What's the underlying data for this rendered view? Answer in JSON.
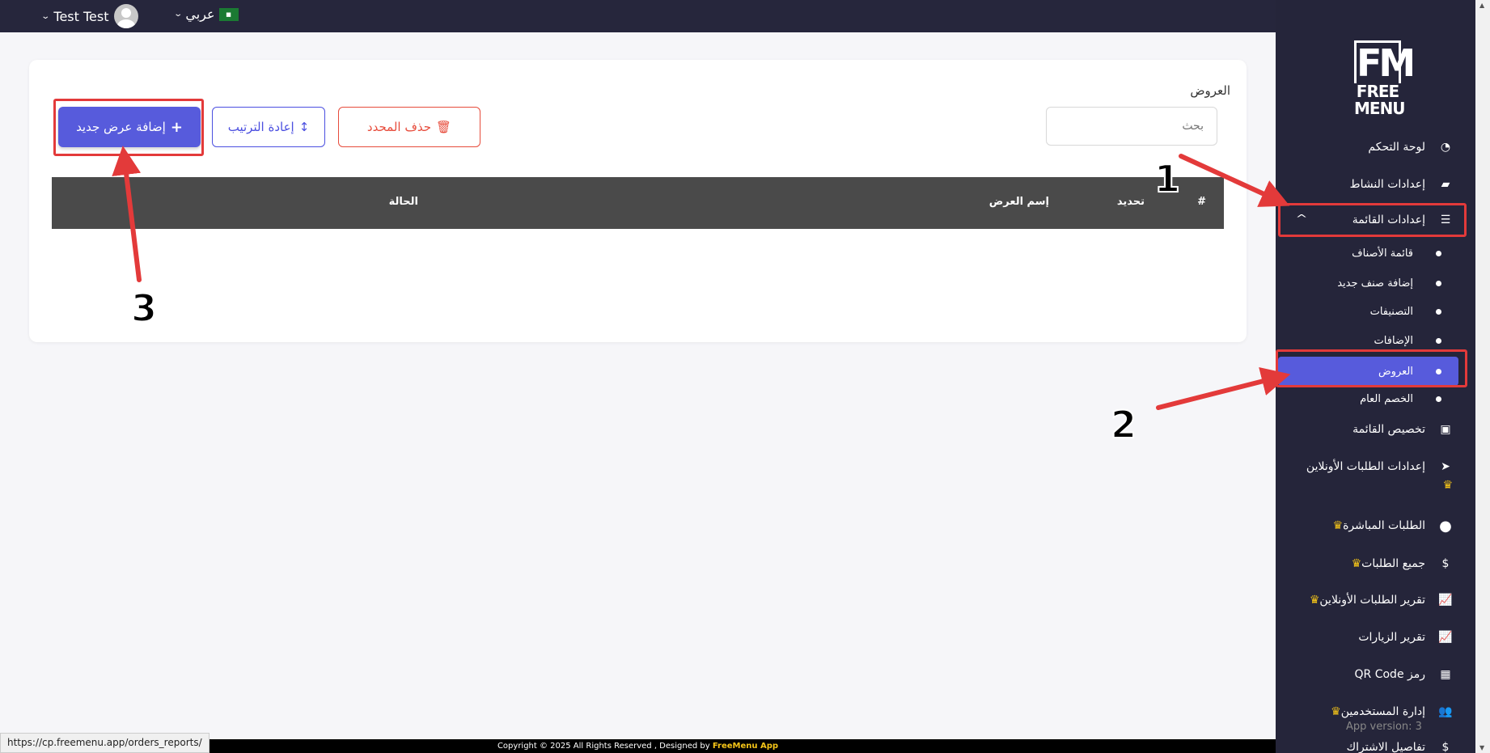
{
  "topbar": {
    "user_name": "Test Test",
    "language": "عربي",
    "flag_text": "Saudi"
  },
  "main": {
    "title": "العروض",
    "search_placeholder": "بحث",
    "delete_selected_label": "حذف المحدد",
    "reorder_label": "إعادة الترتيب",
    "add_offer_label": "إضافة عرض جديد",
    "table_headers": [
      "#",
      "تحديد",
      "إسم العرض",
      "الحالة"
    ]
  },
  "sidebar": {
    "logo_letters": "FM",
    "logo_line1": "FREE",
    "logo_line2": "MENU",
    "items": [
      {
        "label": "لوحة التحكم",
        "icon": "dashboard-icon"
      },
      {
        "label": "إعدادات النشاط",
        "icon": "briefcase-icon"
      },
      {
        "label": "إعدادات القائمة",
        "icon": "burger-icon"
      },
      {
        "label": "تخصيص القائمة",
        "icon": "images-icon"
      },
      {
        "label": "إعدادات الطلبات الأونلاين",
        "icon": "telegram-icon",
        "premium": true
      },
      {
        "label": "الطلبات المباشرة",
        "icon": "circle-icon",
        "premium": true
      },
      {
        "label": "جميع الطلبات",
        "icon": "money-bag-icon",
        "premium": true
      },
      {
        "label": "تقرير الطلبات الأونلاين",
        "icon": "chart-line-icon",
        "premium": true
      },
      {
        "label": "تقرير الزيارات",
        "icon": "chart-line-icon"
      },
      {
        "label": "رمز QR Code",
        "icon": "qrcode-icon"
      },
      {
        "label": "إدارة المستخدمين",
        "icon": "users-icon",
        "premium": true
      },
      {
        "label": "تفاصيل الاشتراك",
        "icon": "subscription-icon"
      }
    ],
    "sub_items": [
      "قائمة الأصناف",
      "إضافة صنف جديد",
      "التصنيفات",
      "الإضافات",
      "العروض",
      "الخصم العام"
    ],
    "active_sub": "العروض",
    "version": "App version: 3"
  },
  "footer": {
    "text": "Copyright © 2025 All Rights Reserved , Designed by",
    "brand": "FreeMenu App"
  },
  "status_url": "https://cp.freemenu.app/orders_reports/",
  "annotations": [
    "1",
    "2",
    "3"
  ],
  "colors": {
    "accent": "#575bdc",
    "sidebar": "#25253a",
    "danger": "#e74c3c",
    "annotation": "#e33a3a",
    "crown": "#f5c518"
  }
}
